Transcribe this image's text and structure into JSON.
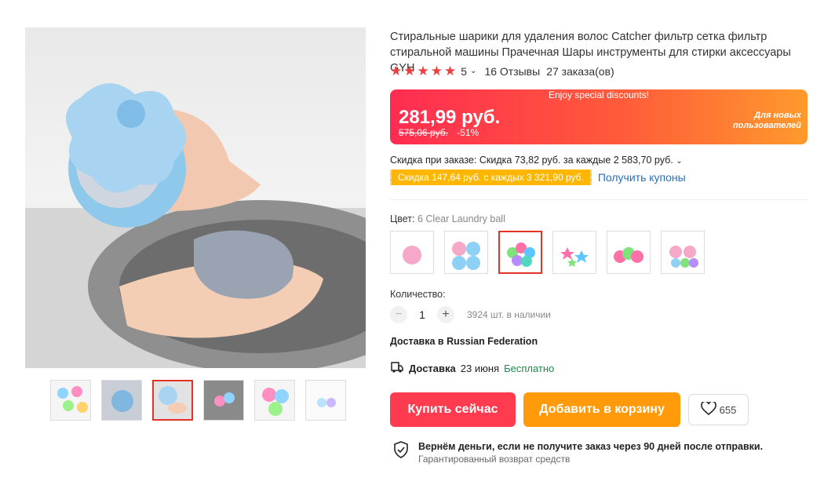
{
  "product": {
    "title": "Стиральные шарики для удаления волос Catcher фильтр сетка фильтр стиральной машины Прачечная Шары инструменты для стирки аксессуары GYH",
    "rating_value": "5",
    "reviews": "16 Отзывы",
    "orders": "27 заказа(ов)",
    "stars": 5
  },
  "price": {
    "banner_text": "Enjoy special discounts!",
    "current": "281,99 руб.",
    "old": "575,06 руб.",
    "discount": "-51%",
    "badge_line1": "Для новых",
    "badge_line2": "пользователей"
  },
  "promo": {
    "order_discount": "Скидка при заказе: Скидка 73,82 руб. за каждые 2 583,70 руб.",
    "coupon_tag": "Скидка 147,64 руб. с каждых 3 321,90 руб.",
    "coupon_link": "Получить купоны"
  },
  "color": {
    "label": "Цвет: ",
    "selected": "6 Clear Laundry ball",
    "options": [
      "pink-ball",
      "blue-pink-flowers",
      "colorful-balls",
      "colorful-stars",
      "pink-green-balls",
      "clear-balls"
    ]
  },
  "quantity": {
    "label": "Количество:",
    "value": "1",
    "minus": "−",
    "plus": "+",
    "stock": "3924 шт. в наличии"
  },
  "shipping": {
    "to_prefix": "Доставка в ",
    "country": "Russian Federation",
    "delivery_label": "Доставка",
    "date": "23 июня",
    "cost": "Бесплатно"
  },
  "actions": {
    "buy": "Купить сейчас",
    "cart": "Добавить в корзину",
    "wishlist_count": "655"
  },
  "guarantee": {
    "title": "Вернём деньги, если не получите заказ через 90 дней после отправки.",
    "subtitle": "Гарантированный возврат средств"
  },
  "colors": {
    "accent": "#ff3b4f",
    "cart": "#ff9a0a",
    "star": "#f03d3d",
    "link": "#2a6ebb",
    "free": "#1e8a4a"
  }
}
